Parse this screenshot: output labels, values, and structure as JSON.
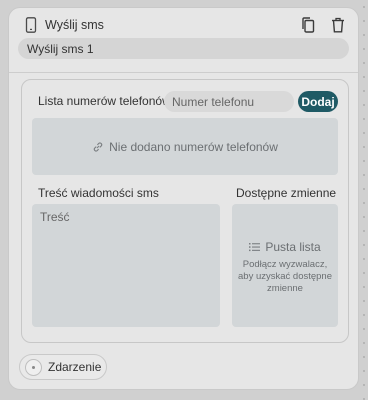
{
  "node": {
    "title": "Wyślij sms",
    "name_value": "Wyślij sms 1",
    "icons": {
      "type": "phone-icon",
      "copy": "copy-icon",
      "delete": "trash-icon"
    }
  },
  "phones": {
    "label": "Lista numerów telefonów",
    "input_placeholder": "Numer telefonu",
    "add_label": "Dodaj",
    "empty_text": "Nie dodano numerów telefonów",
    "empty_icon": "link-icon"
  },
  "message": {
    "label": "Treść wiadomości sms",
    "placeholder": "Treść"
  },
  "variables": {
    "label": "Dostępne zmienne",
    "empty_title": "Pusta lista",
    "empty_desc": "Podłącz wyzwalacz, aby uzyskać dostępne zmienne",
    "empty_icon": "list-icon"
  },
  "event": {
    "label": "Zdarzenie"
  },
  "colors": {
    "accent": "#1f5a65",
    "card": "#e6e6e6",
    "panel": "#d2d6d8",
    "background": "#d0d0d0"
  }
}
